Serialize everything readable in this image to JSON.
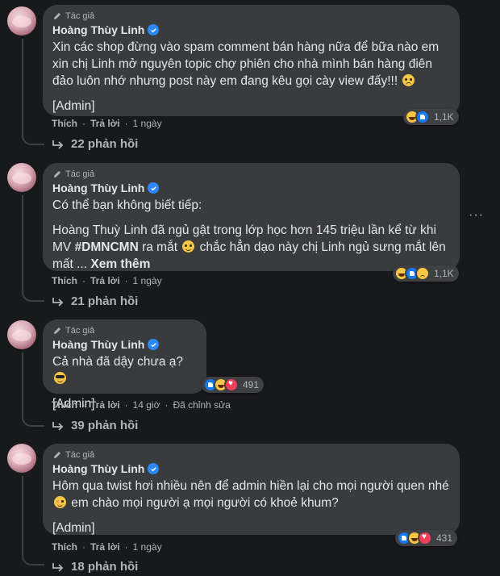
{
  "comments": [
    {
      "badge": "Tác giả",
      "author": "Hoàng Thùy Linh",
      "paragraphs": [
        "Xin các shop đừng vào spam comment bán hàng nữa để bữa nào em xin chị Linh mở nguyên topic chợ phiên cho nhà mình bán hàng điên đảo luôn nhớ nhưng post này em đang kêu gọi cày view đấy!!!",
        "[Admin]"
      ],
      "like": "Thích",
      "reply": "Trả lời",
      "time": "1 ngày",
      "reaction_count": "1,1K",
      "reaction_icons": [
        "haha",
        "like"
      ],
      "replies": "22 phản hồi"
    },
    {
      "badge": "Tác giả",
      "author": "Hoàng Thùy Linh",
      "p1": "Có thể bạn không biết tiếp:",
      "p2_a": "Hoàng Thuỳ Linh đã ngủ gật trong lớp học hơn 145 triệu lần kể từ khi MV ",
      "hashtag": "#DMNCMN",
      "p2_b": " ra mắt ",
      "p2_c": " chắc hẳn dạo này chị Linh ngủ sưng mắt lên mất ... ",
      "see_more": "Xem thêm",
      "like": "Thích",
      "reply": "Trả lời",
      "time": "1 ngày",
      "reaction_count": "1,1K",
      "reaction_icons": [
        "haha",
        "like",
        "sad"
      ],
      "replies": "21 phản hồi",
      "more_icon": "more-horizontal-icon"
    },
    {
      "badge": "Tác giả",
      "author": "Hoàng Thùy Linh",
      "paragraphs": [
        "Cả nhà đã dậy chưa ạ?",
        "[Admin]"
      ],
      "like": "Thích",
      "reply": "Trả lời",
      "time": "14 giờ",
      "edited": "Đã chỉnh sửa",
      "reaction_count": "491",
      "reaction_icons": [
        "like",
        "haha",
        "love"
      ],
      "replies": "39 phản hồi"
    },
    {
      "badge": "Tác giả",
      "author": "Hoàng Thùy Linh",
      "paragraphs": [
        "Hôm qua twist hơi nhiều nên để admin hiền lại cho mọi người quen nhé",
        "[Admin]"
      ],
      "p1_tail": " em chào mọi người ạ mọi người có khoẻ khum?",
      "like": "Thích",
      "reply": "Trả lời",
      "time": "1 ngày",
      "reaction_count": "431",
      "reaction_icons": [
        "like",
        "haha",
        "love"
      ],
      "replies": "18 phản hồi"
    }
  ],
  "colors": {
    "background": "#18191a",
    "bubble": "#3a3b3c",
    "text": "#e4e6eb",
    "muted": "#b0b3b8",
    "verified": "#2d88ff"
  }
}
